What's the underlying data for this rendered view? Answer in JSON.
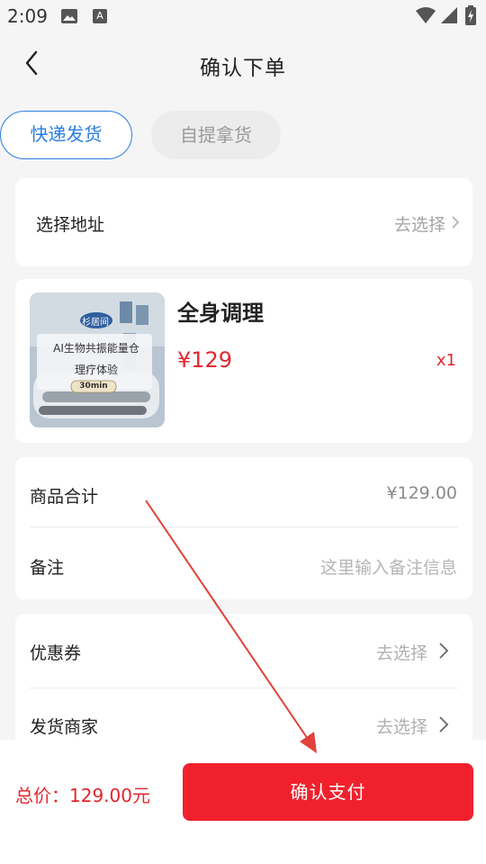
{
  "status_bar": {
    "time": "2:09",
    "a_icon": "A"
  },
  "header": {
    "title": "确认下单"
  },
  "delivery_tabs": {
    "express": "快递发货",
    "pickup": "自提拿货"
  },
  "address": {
    "label": "选择地址",
    "action": "去选择"
  },
  "product": {
    "name": "全身调理",
    "price": "¥129",
    "quantity": "x1",
    "image_text": {
      "brand": "杉居间",
      "line1": "AI生物共振能量仓",
      "line2": "理疗体验",
      "duration": "30min"
    }
  },
  "summary": {
    "subtotal_label": "商品合计",
    "subtotal_value": "¥129.00",
    "remark_label": "备注",
    "remark_placeholder": "这里输入备注信息"
  },
  "options": {
    "coupon_label": "优惠券",
    "coupon_action": "去选择",
    "merchant_label": "发货商家",
    "merchant_action": "去选择"
  },
  "footer": {
    "total": "总价：129.00元",
    "pay_button": "确认支付"
  },
  "colors": {
    "accent_red": "#f0212d",
    "price_red": "#e3262e",
    "tab_blue": "#2b7de1",
    "annotation_arrow": "#e0413a"
  }
}
